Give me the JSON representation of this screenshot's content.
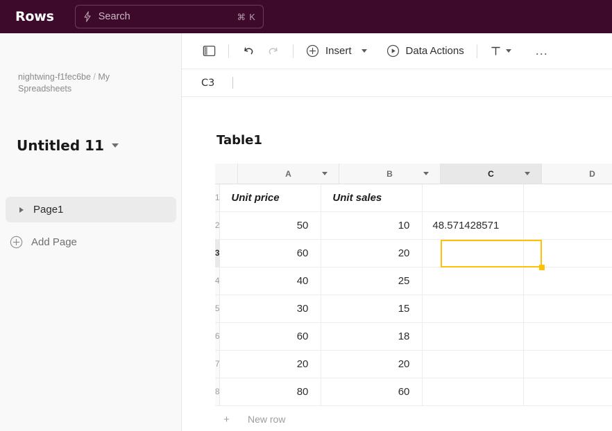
{
  "topbar": {
    "brand": "Rows",
    "search": {
      "icon": "bolt-icon",
      "placeholder": "Search",
      "shortcut": "⌘ K"
    },
    "bg_color": "#3D0A2B"
  },
  "sidebar": {
    "breadcrumb": {
      "workspace": "nightwing-f1fec6be",
      "separator": "/",
      "folder": "My Spreadsheets"
    },
    "document_title": "Untitled 11",
    "pages": [
      {
        "label": "Page1",
        "expanded": false,
        "selected": true
      }
    ],
    "add_page_label": "Add Page"
  },
  "toolbar": {
    "panel_toggle_icon": "sidebar-panel-icon",
    "undo_icon": "undo-icon",
    "redo_icon": "redo-icon",
    "redo_disabled": true,
    "insert_label": "Insert",
    "data_actions_label": "Data Actions",
    "text_format_label": "T",
    "more_label": "…"
  },
  "formula_bar": {
    "cell_reference": "C3",
    "value": ""
  },
  "grid": {
    "table_name": "Table1",
    "columns": [
      {
        "id": "A",
        "label": "A",
        "has_menu": true,
        "active": false
      },
      {
        "id": "B",
        "label": "B",
        "has_menu": true,
        "active": false
      },
      {
        "id": "C",
        "label": "C",
        "has_menu": true,
        "active": true
      },
      {
        "id": "D",
        "label": "D",
        "has_menu": false,
        "active": false
      }
    ],
    "rows": [
      {
        "n": "1",
        "A": "Unit price",
        "B": "Unit sales",
        "C": "",
        "D": "",
        "header_row": true,
        "active": false
      },
      {
        "n": "2",
        "A": "50",
        "B": "10",
        "C": "48.571428571",
        "D": "",
        "header_row": false,
        "active": false
      },
      {
        "n": "3",
        "A": "60",
        "B": "20",
        "C": "",
        "D": "",
        "header_row": false,
        "active": true
      },
      {
        "n": "4",
        "A": "40",
        "B": "25",
        "C": "",
        "D": "",
        "header_row": false,
        "active": false
      },
      {
        "n": "5",
        "A": "30",
        "B": "15",
        "C": "",
        "D": "",
        "header_row": false,
        "active": false
      },
      {
        "n": "6",
        "A": "60",
        "B": "18",
        "C": "",
        "D": "",
        "header_row": false,
        "active": false
      },
      {
        "n": "7",
        "A": "20",
        "B": "20",
        "C": "",
        "D": "",
        "header_row": false,
        "active": false
      },
      {
        "n": "8",
        "A": "80",
        "B": "60",
        "C": "",
        "D": "",
        "header_row": false,
        "active": false
      }
    ],
    "new_row": {
      "plus": "+",
      "label": "New row"
    },
    "selection": {
      "cell": "C3",
      "border_color": "#FFC107",
      "handle_color": "#FFC107"
    }
  }
}
